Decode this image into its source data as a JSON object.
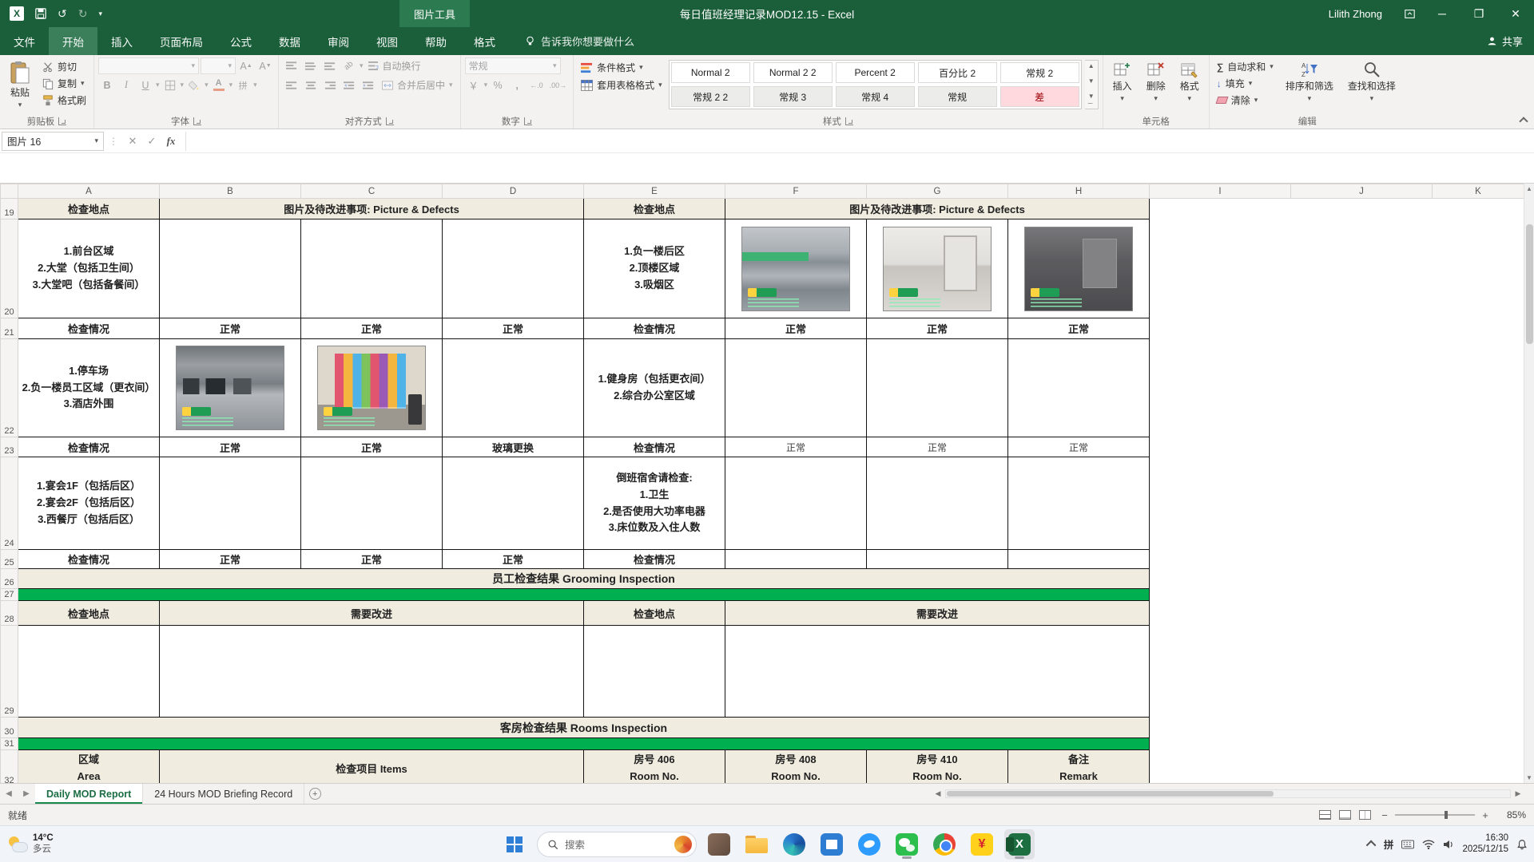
{
  "titlebar": {
    "context_tab_group": "图片工具",
    "title": "每日值班经理记录MOD12.15 - Excel",
    "user": "Lilith Zhong"
  },
  "ribbon": {
    "tabs": [
      "文件",
      "开始",
      "插入",
      "页面布局",
      "公式",
      "数据",
      "审阅",
      "视图",
      "帮助",
      "格式"
    ],
    "tell_me": "告诉我你想要做什么",
    "share": "共享",
    "clipboard": {
      "label": "剪贴板",
      "paste": "粘贴",
      "cut": "剪切",
      "copy": "复制",
      "painter": "格式刷"
    },
    "font": {
      "label": "字体"
    },
    "alignment": {
      "label": "对齐方式",
      "wrap": "自动换行",
      "merge": "合并后居中"
    },
    "number": {
      "label": "数字",
      "format": "常规"
    },
    "styles": {
      "label": "样式",
      "conditional": "条件格式",
      "table_format": "套用表格格式",
      "gallery": [
        "Normal 2",
        "Normal 2 2",
        "Percent 2",
        "百分比 2",
        "常规 2",
        "常规 2 2",
        "常规 3",
        "常规 4",
        "常规",
        "差"
      ]
    },
    "cells": {
      "label": "单元格",
      "insert": "插入",
      "delete": "删除",
      "format": "格式"
    },
    "editing": {
      "label": "编辑",
      "autosum": "自动求和",
      "fill": "填充",
      "clear": "清除",
      "sort": "排序和筛选",
      "find": "查找和选择"
    }
  },
  "formula_bar": {
    "name_box": "图片 16",
    "fx": "fx"
  },
  "grid": {
    "col_headers": [
      "A",
      "B",
      "C",
      "D",
      "E",
      "F",
      "G",
      "H",
      "I",
      "J",
      "K"
    ],
    "rows": [
      "19",
      "20",
      "21",
      "22",
      "23",
      "24",
      "25",
      "26",
      "27",
      "28",
      "29",
      "30",
      "31",
      "32"
    ],
    "cells": {
      "a19": "检查地点",
      "bd19": "图片及待改进事项: Picture & Defects",
      "e19": "检查地点",
      "fh19": "图片及待改进事项: Picture & Defects",
      "a20": "1.前台区域\n2.大堂（包括卫生间）\n3.大堂吧（包括备餐间）",
      "e20": "1.负一楼后区\n2.顶楼区域\n3.吸烟区",
      "a21": "检查情况",
      "b21": "正常",
      "c21": "正常",
      "d21": "正常",
      "e21": "检查情况",
      "f21": "正常",
      "g21": "正常",
      "h21": "正常",
      "a22": "1.停车场\n2.负一楼员工区域（更衣间）\n3.酒店外围",
      "e22": "1.健身房（包括更衣间）\n2.综合办公室区域",
      "a23": "检查情况",
      "b23": "正常",
      "c23": "正常",
      "d23": "玻璃更换",
      "e23": "检查情况",
      "f23": "正常",
      "g23": "正常",
      "h23": "正常",
      "a24": "1.宴会1F（包括后区）\n2.宴会2F（包括后区）\n3.西餐厅（包括后区）",
      "e24": "倒班宿舍请检查:\n1.卫生\n2.是否使用大功率电器\n3.床位数及入住人数",
      "a25": "检查情况",
      "b25": "正常",
      "c25": "正常",
      "d25": "正常",
      "e25": "检查情况",
      "t26": "员工检查结果  Grooming Inspection",
      "a28": "检查地点",
      "bd28": "需要改进",
      "e28": "检查地点",
      "fh28": "需要改进",
      "t30": "客房检查结果  Rooms Inspection",
      "a32": "区域\nArea",
      "bd32": "检查项目 Items",
      "e32": "房号 406\nRoom No.",
      "f32": "房号 408\nRoom No.",
      "g32": "房号 410\nRoom No.",
      "h32": "备注\nRemark"
    }
  },
  "sheet_tabs": {
    "tab1": "Daily MOD Report",
    "tab2": "24 Hours MOD Briefing Record"
  },
  "status_bar": {
    "ready": "就绪",
    "zoom": "85%"
  },
  "taskbar": {
    "weather_temp": "14°C",
    "weather_desc": "多云",
    "search_placeholder": "搜索",
    "ime": "拼",
    "yuan_glyph": "¥",
    "excel_glyph": "X",
    "time": "16:30",
    "date": "2025/12/15"
  }
}
